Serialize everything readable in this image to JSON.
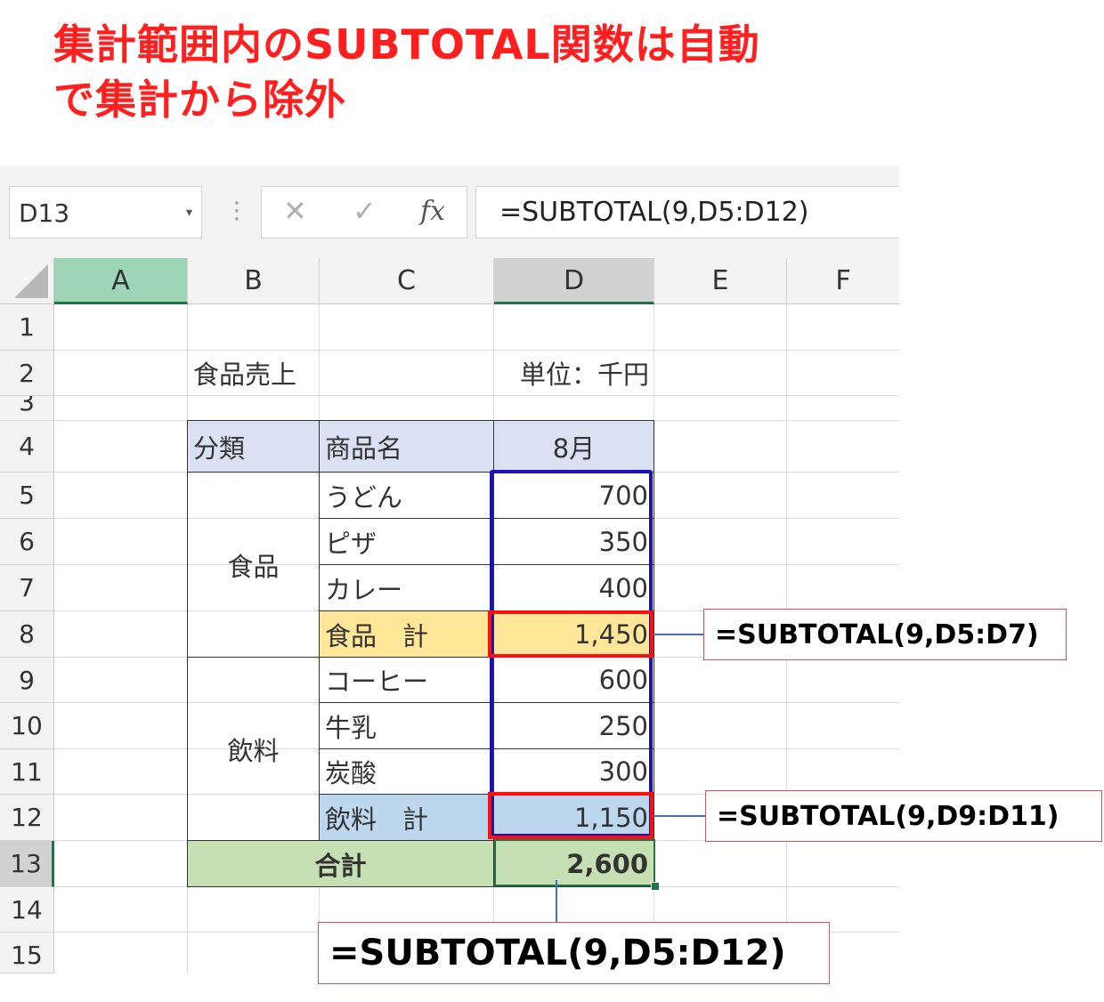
{
  "title": {
    "line1": "集計範囲内のSUBTOTAL関数は自動",
    "line2": "で集計から除外"
  },
  "formula_bar": {
    "name_box": "D13",
    "cancel_icon": "✕",
    "enter_icon": "✓",
    "fx_label": "fx",
    "formula": "=SUBTOTAL(9,D5:D12)"
  },
  "columns": [
    "A",
    "B",
    "C",
    "D",
    "E",
    "F"
  ],
  "rows": [
    "1",
    "2",
    "3",
    "4",
    "5",
    "6",
    "7",
    "8",
    "9",
    "10",
    "11",
    "12",
    "13",
    "14",
    "15"
  ],
  "sheet": {
    "b2": "食品売上",
    "d2": "単位：千円",
    "header": {
      "category": "分類",
      "product": "商品名",
      "month": "8月"
    },
    "group_food": "食品",
    "group_drink": "飲料",
    "items": [
      {
        "name": "うどん",
        "value": "700"
      },
      {
        "name": "ピザ",
        "value": "350"
      },
      {
        "name": "カレー",
        "value": "400"
      },
      {
        "name": "食品　計",
        "value": "1,450"
      },
      {
        "name": "コーヒー",
        "value": "600"
      },
      {
        "name": "牛乳",
        "value": "250"
      },
      {
        "name": "炭酸",
        "value": "300"
      },
      {
        "name": "飲料　計",
        "value": "1,150"
      }
    ],
    "total_label": "合計",
    "total_value": "2,600"
  },
  "callouts": {
    "food_subtotal": "=SUBTOTAL(9,D5:D7)",
    "drink_subtotal": "=SUBTOTAL(9,D9:D11)",
    "grand_total": "=SUBTOTAL(9,D5:D12)"
  },
  "colors": {
    "title_red": "#ff1f1f",
    "header_fill": "#d9e1f2",
    "food_total_fill": "#ffe699",
    "drink_total_fill": "#bdd7ee",
    "grand_total_fill": "#c6e0b4",
    "range_blue": "#1a12b8",
    "highlight_red": "#ff0f0f",
    "excel_green": "#217346"
  }
}
